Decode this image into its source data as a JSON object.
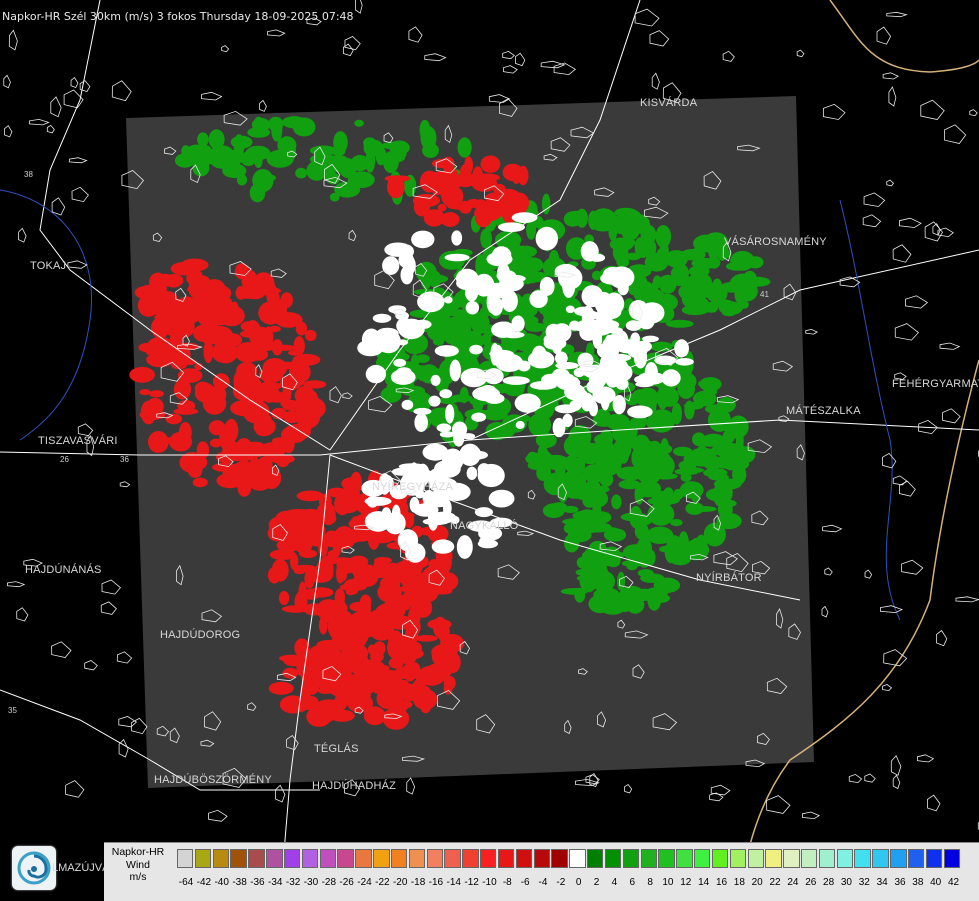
{
  "header": {
    "title": "Napkor-HR Szél 30km (m/s) 3 fokos Thursday 18-09-2025 07:48"
  },
  "cities": [
    {
      "name": "KISVÁRDA"
    },
    {
      "name": "VÁSÁROSNAMÉNY"
    },
    {
      "name": "TOKAJ"
    },
    {
      "name": "FEHÉRGYARMAT"
    },
    {
      "name": "MÁTÉSZALKA"
    },
    {
      "name": "TISZAVASVÁRI"
    },
    {
      "name": "NYÍREGYHÁZA"
    },
    {
      "name": "NAGYKÁLLÓ"
    },
    {
      "name": "HAJDÚNÁNÁS"
    },
    {
      "name": "NYÍRBÁTOR"
    },
    {
      "name": "HAJDÚDOROG"
    },
    {
      "name": "TÉGLÁS"
    },
    {
      "name": "HAJDÚBÖSZÖRMÉNY"
    },
    {
      "name": "HAJDÚHADHÁZ"
    },
    {
      "name": "LMAZÚJVÁR"
    }
  ],
  "road_numbers": [
    "38",
    "26",
    "36",
    "35",
    "41"
  ],
  "legend": {
    "title_lines": [
      "Napkor-HR",
      "Wind",
      "m/s"
    ],
    "ticks": [
      "-64",
      "-42",
      "-40",
      "-38",
      "-36",
      "-34",
      "-32",
      "-30",
      "-28",
      "-26",
      "-24",
      "-22",
      "-20",
      "-18",
      "-16",
      "-14",
      "-12",
      "-10",
      "-8",
      "-6",
      "-4",
      "-2",
      "0",
      "2",
      "4",
      "6",
      "8",
      "10",
      "12",
      "14",
      "16",
      "18",
      "20",
      "22",
      "24",
      "26",
      "28",
      "30",
      "32",
      "34",
      "36",
      "38",
      "40",
      "42"
    ],
    "colors": [
      "#d4d4d4",
      "#a8a814",
      "#b88a10",
      "#a0520a",
      "#a84c4c",
      "#b050a0",
      "#a040e8",
      "#b060e0",
      "#c050c0",
      "#c84890",
      "#e87840",
      "#f0a010",
      "#f08020",
      "#f09050",
      "#f08060",
      "#f06050",
      "#f04030",
      "#f82020",
      "#e81818",
      "#d01010",
      "#b80808",
      "#a00000",
      "#ffffff",
      "#008000",
      "#009000",
      "#10a010",
      "#20b020",
      "#20c020",
      "#40e040",
      "#40f040",
      "#60f020",
      "#a0f060",
      "#c0f0a0",
      "#f0f080",
      "#e0f0c0",
      "#c0f0c0",
      "#a0f0d0",
      "#80f0e0",
      "#40e0f0",
      "#30c8f0",
      "#20a0f0",
      "#2060f0",
      "#1030f0",
      "#0000e0"
    ]
  },
  "colors": {
    "radar_bg": "#3a3a3a",
    "inbound_green": "#10a010",
    "outbound_red": "#e81818",
    "page_bg": "#000000"
  }
}
